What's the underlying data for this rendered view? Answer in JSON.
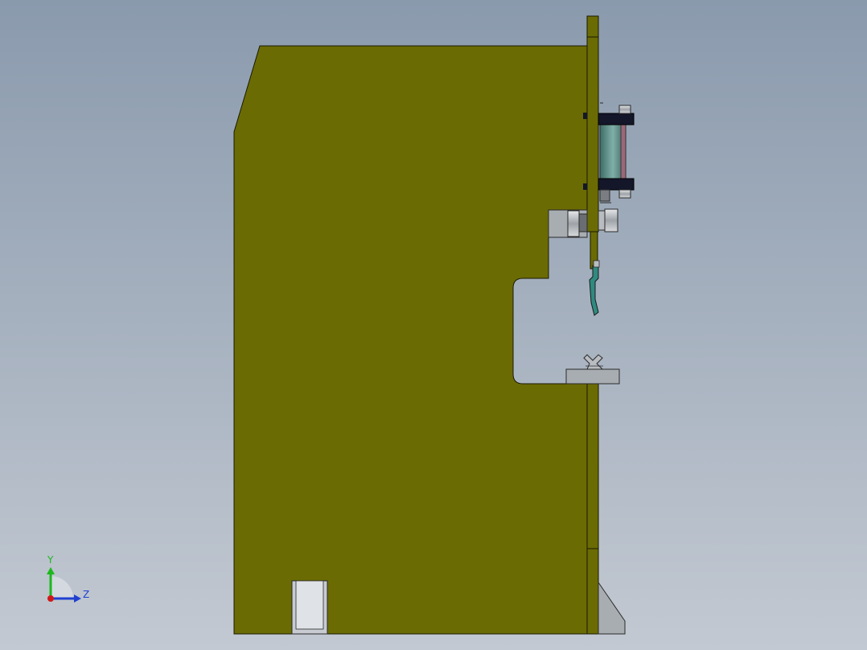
{
  "view": {
    "background_top": "#8a9aad",
    "background_bottom": "#c3c9d2"
  },
  "model": {
    "frame_color": "#6b6b04",
    "cylinder_color": "#5a8a80",
    "steel_color": "#a8adb2",
    "bracket_color": "#14162a",
    "punch_color": "#2f8a80"
  },
  "triad": {
    "y_label": "Y",
    "z_label": "Z",
    "y_color": "#1cb81c",
    "z_color": "#2040d0",
    "x_color": "#d01818"
  }
}
